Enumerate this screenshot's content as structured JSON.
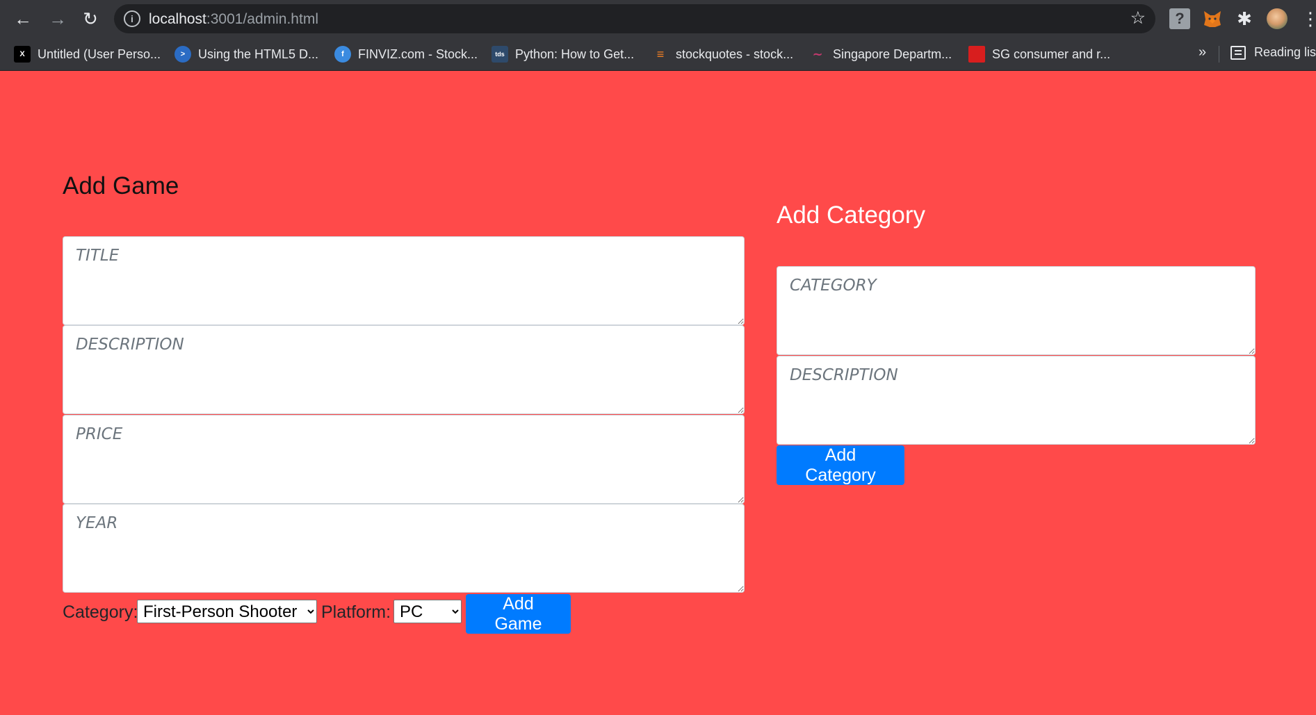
{
  "browser": {
    "url_host": "localhost",
    "url_path": ":3001/admin.html",
    "bookmarks": [
      {
        "label": "Untitled (User Perso...",
        "icon": "x-logo-icon",
        "color": "#000000"
      },
      {
        "label": "Using the HTML5 D...",
        "icon": "powershell-icon",
        "color": "#2b6cc4"
      },
      {
        "label": "FINVIZ.com - Stock...",
        "icon": "facebook-icon",
        "color": "#3b8be0"
      },
      {
        "label": "Python: How to Get...",
        "icon": "tds-icon",
        "color": "#2e4a6b"
      },
      {
        "label": "stockquotes - stock...",
        "icon": "stackoverflow-icon",
        "color": "#f48024"
      },
      {
        "label": "Singapore Departm...",
        "icon": "swoosh-icon",
        "color": "#c43a6e"
      },
      {
        "label": "SG consumer and r...",
        "icon": "red-flag-icon",
        "color": "#d81e1e"
      }
    ],
    "more_label": "»",
    "reading_list_label": "Reading list"
  },
  "game_form": {
    "heading": "Add Game",
    "title_placeholder": "TITLE",
    "description_placeholder": "DESCRIPTION",
    "price_placeholder": "PRICE",
    "year_placeholder": "YEAR",
    "category_label": "Category:",
    "category_selected": "First-Person Shooter",
    "platform_label": "Platform:",
    "platform_selected": "PC",
    "submit_label": "Add Game"
  },
  "category_form": {
    "heading": "Add Category",
    "category_placeholder": "CATEGORY",
    "description_placeholder": "DESCRIPTION",
    "submit_label": "Add Category"
  },
  "colors": {
    "page_background": "#ff4a4a",
    "button": "#007bff",
    "chrome": "#35363a"
  }
}
